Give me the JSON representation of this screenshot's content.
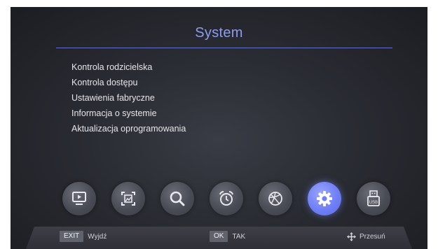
{
  "header": {
    "title": "System"
  },
  "menu": {
    "items": [
      {
        "label": "Kontrola rodzicielska"
      },
      {
        "label": "Kontrola dostępu"
      },
      {
        "label": "Ustawienia fabryczne"
      },
      {
        "label": "Informacja o systemie"
      },
      {
        "label": "Aktualizacja oprogramowania"
      }
    ]
  },
  "icon_bar": {
    "items": [
      {
        "icon": "media-player-icon",
        "active": false
      },
      {
        "icon": "picture-icon",
        "active": false
      },
      {
        "icon": "search-icon",
        "active": false
      },
      {
        "icon": "alarm-clock-icon",
        "active": false
      },
      {
        "icon": "ball-icon",
        "active": false
      },
      {
        "icon": "gear-icon",
        "active": true
      },
      {
        "icon": "usb-icon",
        "active": false
      }
    ],
    "active_color": "#7b8cff"
  },
  "footer": {
    "exit_key": "EXIT",
    "exit_label": "Wyjdź",
    "ok_key": "OK",
    "ok_label": "TAK",
    "move_label": "Przesuń"
  },
  "colors": {
    "title": "#8f9cf0",
    "accent_line": "#6f7fe0",
    "text": "#e6e6ea"
  }
}
